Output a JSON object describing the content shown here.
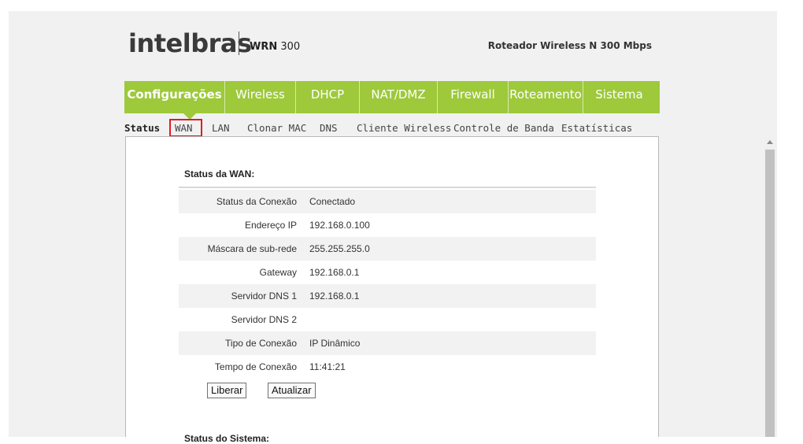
{
  "header": {
    "logo": "intelbras",
    "model_prefix": "WRN",
    "model_number": "300",
    "tagline": "Roteador Wireless N 300 Mbps"
  },
  "main_nav": {
    "items": [
      {
        "label": "Configurações",
        "active": true
      },
      {
        "label": "Wireless"
      },
      {
        "label": "DHCP"
      },
      {
        "label": "NAT/DMZ"
      },
      {
        "label": "Firewall"
      },
      {
        "label": "Roteamento"
      },
      {
        "label": "Sistema"
      }
    ]
  },
  "sub_nav": {
    "items": [
      "Status",
      "WAN",
      "LAN",
      "Clonar MAC",
      "DNS",
      "Cliente Wireless",
      "Controle de Banda",
      "Estatísticas"
    ],
    "current": "Status",
    "highlighted": "WAN"
  },
  "wan_status": {
    "title": "Status da WAN:",
    "rows": [
      {
        "label": "Status da Conexão",
        "value": "Conectado"
      },
      {
        "label": "Endereço IP",
        "value": "192.168.0.100"
      },
      {
        "label": "Máscara de sub-rede",
        "value": "255.255.255.0"
      },
      {
        "label": "Gateway",
        "value": "192.168.0.1"
      },
      {
        "label": "Servidor DNS 1",
        "value": "192.168.0.1"
      },
      {
        "label": "Servidor DNS 2",
        "value": ""
      },
      {
        "label": "Tipo de Conexão",
        "value": "IP Dinâmico"
      },
      {
        "label": "Tempo de Conexão",
        "value": "11:41:21"
      }
    ],
    "buttons": {
      "release": "Liberar",
      "refresh": "Atualizar"
    }
  },
  "next_section": {
    "title": "Status do Sistema:"
  },
  "colors": {
    "nav_green": "#9dc93b",
    "highlight_red": "#e11b22"
  }
}
